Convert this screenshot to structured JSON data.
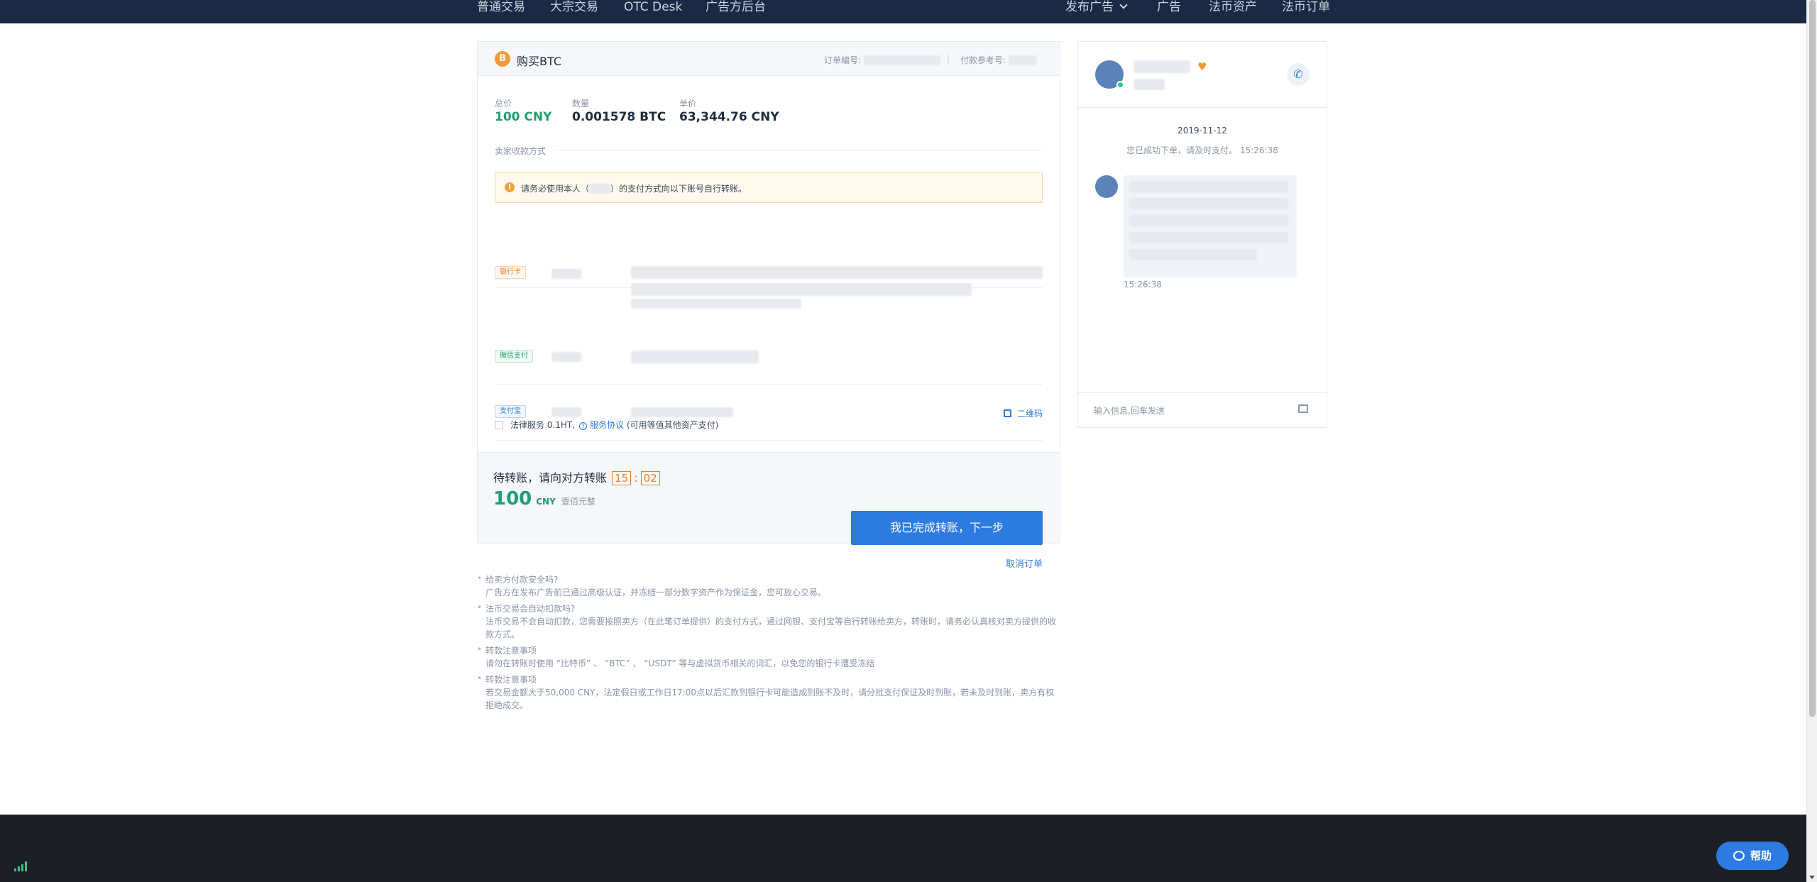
{
  "nav": {
    "left": [
      "普通交易",
      "大宗交易",
      "OTC Desk",
      "广告方后台"
    ],
    "publish_ad": "发布广告",
    "right": [
      "广告",
      "法币资产",
      "法币订单"
    ]
  },
  "order": {
    "coin_symbol": "B",
    "title": "购买BTC",
    "order_no_label": "订单编号:",
    "ref_label": "付款参考号:",
    "total_label": "总价",
    "total_value": "100 CNY",
    "qty_label": "数量",
    "qty_value": "0.001578 BTC",
    "price_label": "单价",
    "price_value": "63,344.76 CNY",
    "seller_methods_label": "卖家收款方式",
    "warning_pre": "请务必使用本人（",
    "warning_post": "）的支付方式向以下账号自行转账。",
    "payments": [
      {
        "tag": "银行卡"
      },
      {
        "tag": "微信支付"
      },
      {
        "tag": "支付宝",
        "qr": "二维码"
      }
    ],
    "legal_text": "法律服务 0.1HT,",
    "service_agreement": "服务协议",
    "legal_suffix": "(可用等值其他资产支付)",
    "wait_text": "待转账，请向对方转账",
    "timer_min": "15",
    "timer_sec": "02",
    "amount": "100",
    "amount_currency": "CNY",
    "amount_words": "壹佰元整",
    "confirm_button": "我已完成转账，下一步",
    "cancel_link": "取消订单"
  },
  "faq": [
    {
      "q": "给卖方付款安全吗?",
      "a": "广告方在发布广告前已通过高级认证，并冻结一部分数字资产作为保证金，您可放心交易。"
    },
    {
      "q": "法币交易会自动扣款吗?",
      "a": "法币交易不会自动扣款，您需要按照卖方（在此笔订单提供）的支付方式，通过网银、支付宝等自行转账给卖方，转账时，请务必认真核对卖方提供的收款方式。"
    },
    {
      "q": "转款注意事项",
      "a": "请勿在转账时使用 “比特币” 、 “BTC” 、 “USDT” 等与虚拟货币相关的词汇，以免您的银行卡遭受冻结"
    },
    {
      "q": "转款注意事项",
      "a": "若交易金额大于50,000 CNY，法定假日或工作日17:00点以后汇款到银行卡可能造成到账不及时，请分批支付保证及时到账，若未及时到账，卖方有权拒绝成交。"
    }
  ],
  "chat": {
    "date": "2019-11-12",
    "system_msg": "您已成功下单，请及时支付。 15:26:38",
    "msg_time": "15:26:38",
    "input_placeholder": "输入信息,回车发送"
  },
  "help_button": "帮助",
  "icons": [
    "bitcoin-icon",
    "chevron-down-icon",
    "warning-icon",
    "qrcode-icon",
    "info-icon",
    "phone-icon",
    "image-icon",
    "heart-icon",
    "chat-help-icon",
    "signal-icon"
  ],
  "colors": {
    "accent": "#2d7be0",
    "green": "#1f9e6e",
    "orange": "#e5812c",
    "nav_bg": "#1a2a45",
    "footer_bg": "#1c1f26"
  }
}
